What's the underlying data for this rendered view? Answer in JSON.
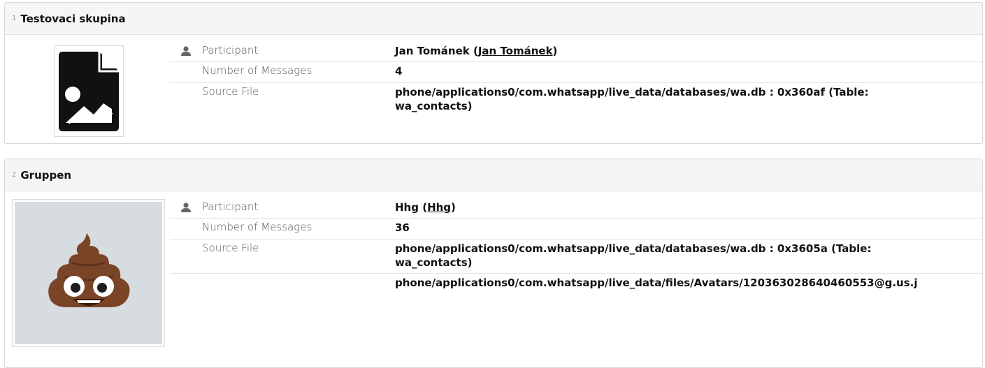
{
  "cards": [
    {
      "index": "1",
      "title": "Testovaci skupina",
      "image": "broken-image-icon",
      "fields": {
        "participant_label": "Participant",
        "participant_name": "Jan Tománek",
        "participant_open": " (",
        "participant_link": "Jan Tománek",
        "participant_close": ")",
        "messages_label": "Number of Messages",
        "messages_value": "4",
        "source_label": "Source File",
        "source_value": "phone/applications0/com.whatsapp/live_data/databases/wa.db : 0x360af (Table: wa_contacts)"
      }
    },
    {
      "index": "2",
      "title": "Gruppen",
      "image": "poop-emoji-avatar",
      "fields": {
        "participant_label": "Participant",
        "participant_name": "Hhg",
        "participant_open": " (",
        "participant_link": "Hhg",
        "participant_close": ")",
        "messages_label": "Number of Messages",
        "messages_value": "36",
        "source_label": "Source File",
        "source_value": "phone/applications0/com.whatsapp/live_data/databases/wa.db : 0x3605a (Table: wa_contacts)",
        "source_value_2": "phone/applications0/com.whatsapp/live_data/files/Avatars/120363028640460553@g.us.j"
      }
    }
  ],
  "colors": {
    "header_bg": "#f5f5f5",
    "border": "#d9d9d9",
    "text": "#111111",
    "label": "#555555"
  }
}
